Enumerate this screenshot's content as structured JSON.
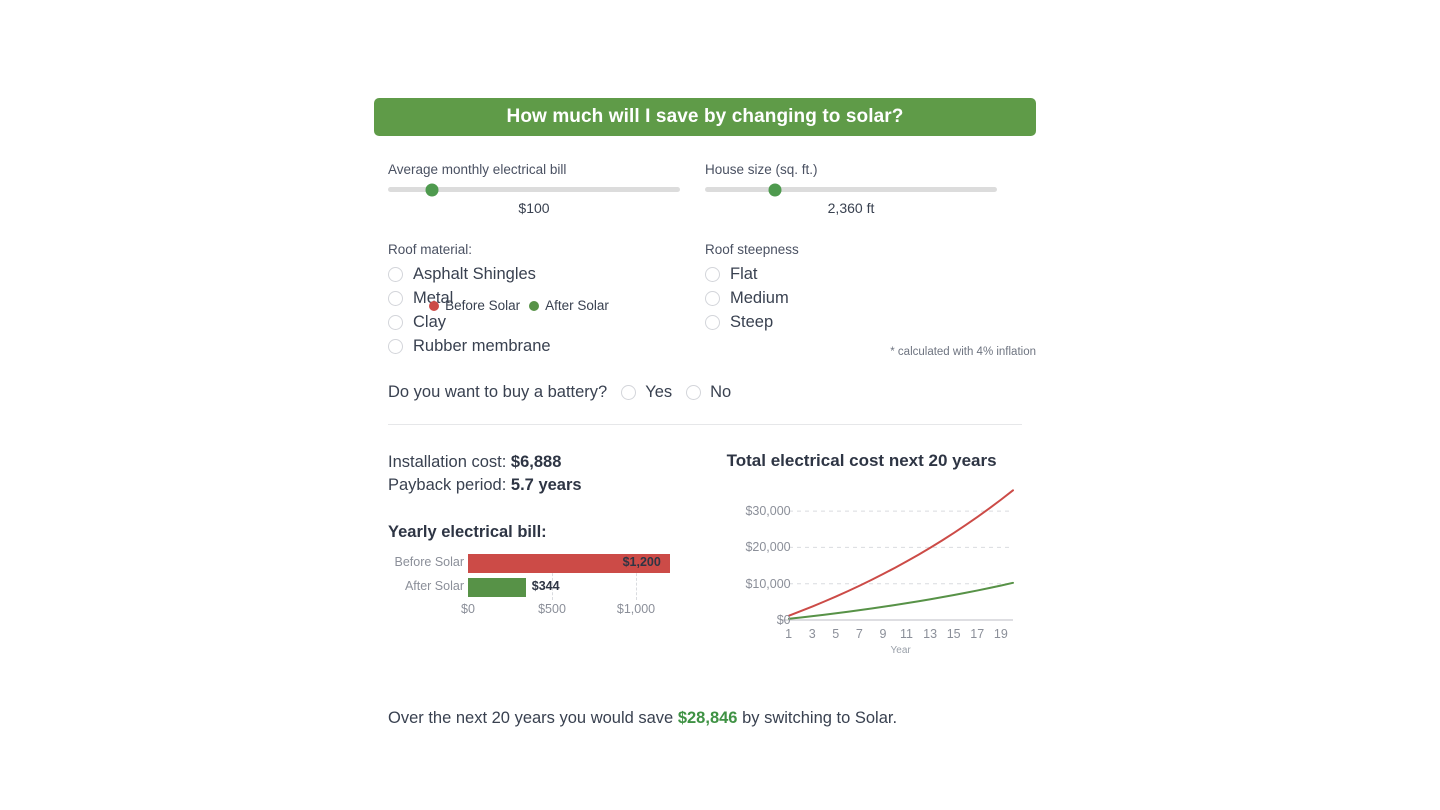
{
  "header": {
    "title": "How much will I save by changing to solar?",
    "bg_color": "#5F9B48"
  },
  "sliders": [
    {
      "label": "Average monthly electrical bill",
      "value_text": "$100",
      "thumb_percent": 15
    },
    {
      "label": "House size (sq. ft.)",
      "value_text": "2,360 ft",
      "thumb_percent": 24
    }
  ],
  "radio_groups": [
    {
      "label": "Roof material:",
      "options": [
        "Asphalt Shingles",
        "Metal",
        "Clay",
        "Rubber membrane"
      ],
      "selected": null
    },
    {
      "label": "Roof steepness",
      "options": [
        "Flat",
        "Medium",
        "Steep"
      ],
      "selected": null
    }
  ],
  "battery": {
    "question": "Do you want to buy a battery?",
    "options": [
      "Yes",
      "No"
    ],
    "selected": null
  },
  "results": {
    "installation_label": "Installation cost:",
    "installation_value": "$6,888",
    "payback_label": "Payback period:",
    "payback_value": "5.7 years",
    "bar_heading": "Yearly electrical bill:"
  },
  "summary": {
    "prefix": "Over the next 20 years you would save ",
    "amount": "$28,846",
    "suffix": " by switching to Solar.",
    "amount_color": "#3f9244"
  },
  "footnote": "* calculated with 4% inflation",
  "colors": {
    "before_solar": "#CC4B47",
    "after_solar": "#579247"
  },
  "chart_data": [
    {
      "type": "bar",
      "orientation": "horizontal",
      "title": "Yearly electrical bill:",
      "categories": [
        "Before Solar",
        "After Solar"
      ],
      "values": [
        1200,
        344
      ],
      "value_labels": [
        "$1,200",
        "$344"
      ],
      "colors": [
        "#CC4B47",
        "#579247"
      ],
      "xlabel": "",
      "ylabel": "",
      "xlim": [
        0,
        1200
      ],
      "xticks": [
        0,
        500,
        1000
      ],
      "xtick_labels": [
        "$0",
        "$500",
        "$1,000"
      ],
      "grid": true
    },
    {
      "type": "line",
      "title": "Total electrical cost next 20 years",
      "xlabel": "Year",
      "ylabel": "",
      "xlim": [
        1,
        20
      ],
      "ylim": [
        0,
        35000
      ],
      "yticks": [
        0,
        10000,
        20000,
        30000
      ],
      "ytick_labels": [
        "$0",
        "$10,000",
        "$20,000",
        "$30,000"
      ],
      "xticks": [
        1,
        3,
        5,
        7,
        9,
        11,
        13,
        15,
        17,
        19
      ],
      "xtick_labels": [
        "1",
        "3",
        "5",
        "7",
        "9",
        "11",
        "13",
        "15",
        "17",
        "19"
      ],
      "grid": true,
      "legend_position": "bottom",
      "series": [
        {
          "name": "Before Solar",
          "color": "#CC4B47",
          "x": [
            1,
            2,
            3,
            4,
            5,
            6,
            7,
            8,
            9,
            10,
            11,
            12,
            13,
            14,
            15,
            16,
            17,
            18,
            19,
            20
          ],
          "values": [
            1200,
            2448,
            3746,
            5096,
            6500,
            7960,
            9478,
            11057,
            12699,
            14407,
            16184,
            18031,
            19952,
            21950,
            24028,
            26189,
            28437,
            30774,
            33205,
            35733
          ]
        },
        {
          "name": "After Solar",
          "color": "#579247",
          "x": [
            1,
            2,
            3,
            4,
            5,
            6,
            7,
            8,
            9,
            10,
            11,
            12,
            13,
            14,
            15,
            16,
            17,
            18,
            19,
            20
          ],
          "values": [
            344,
            702,
            1074,
            1461,
            1863,
            2282,
            2717,
            3170,
            3641,
            4130,
            4640,
            5169,
            5720,
            6293,
            6889,
            7509,
            8153,
            8823,
            9520,
            10245
          ]
        }
      ]
    }
  ]
}
